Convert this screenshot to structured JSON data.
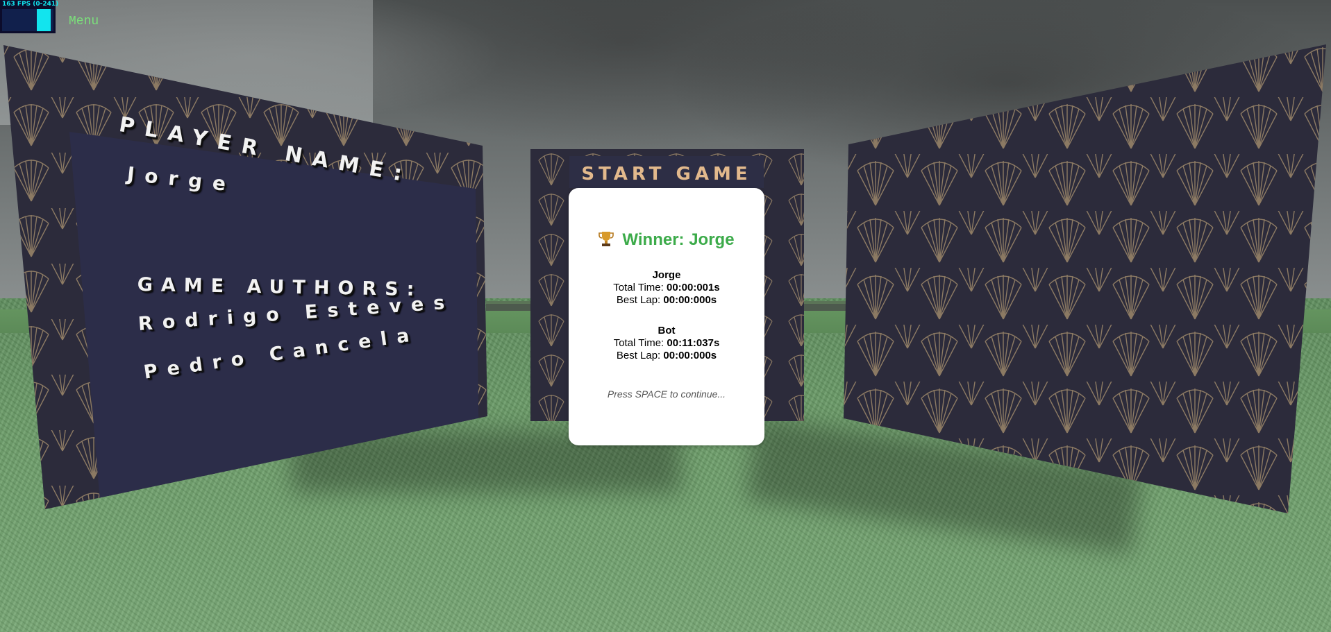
{
  "hud": {
    "fps_label": "163 FPS (0-241)",
    "menu_label": "Menu"
  },
  "scene": {
    "left_board": {
      "player_name_heading": "PLAYER NAME:",
      "player_name": "Jorge",
      "authors_heading": "GAME AUTHORS:",
      "authors": [
        "Rodrigo Esteves",
        "Pedro Cancela"
      ]
    },
    "center_board": {
      "title": "START GAME"
    }
  },
  "results": {
    "winner_text": "Winner: Jorge",
    "players": [
      {
        "name": "Jorge",
        "total_time_label": "Total Time:",
        "total_time": "00:00:001s",
        "best_lap_label": "Best Lap:",
        "best_lap": "00:00:000s"
      },
      {
        "name": "Bot",
        "total_time_label": "Total Time:",
        "total_time": "00:11:037s",
        "best_lap_label": "Best Lap:",
        "best_lap": "00:00:000s"
      }
    ],
    "prompt": "Press SPACE to continue..."
  },
  "colors": {
    "winner": "#3cab4a",
    "menu": "#7be07b",
    "fps": "#12e4ee",
    "board": "#2c2d49",
    "pattern": "#8c7a63",
    "start_title": "#e2b98c"
  }
}
